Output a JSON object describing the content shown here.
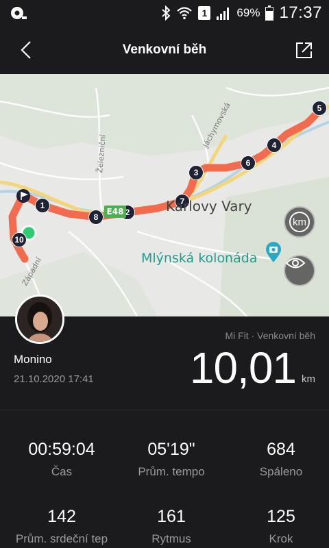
{
  "status_bar": {
    "sim_label": "1",
    "battery": "69%",
    "time": "17:37"
  },
  "header": {
    "title": "Venkovní běh"
  },
  "map": {
    "city_label": "Karlovy Vary",
    "poi_label": "Mlýnská kolonáda",
    "highway_label": "E48",
    "streets": [
      "Železniční",
      "Jáchymovská",
      "Západní"
    ],
    "unit_button": "km",
    "route_color": "#f26b4f",
    "km_markers": [
      "1",
      "2",
      "3",
      "4",
      "5",
      "6",
      "7",
      "8",
      "10"
    ]
  },
  "activity": {
    "source": "Mi Fit · Venkovní běh",
    "user_name": "Monino",
    "date": "21.10.2020 17:41",
    "distance": "10,01",
    "distance_unit": "km"
  },
  "stats": [
    {
      "value": "00:59:04",
      "label": "Čas"
    },
    {
      "value": "05'19\"",
      "label": "Prům. tempo"
    },
    {
      "value": "684",
      "label": "Spáleno"
    },
    {
      "value": "142",
      "label": "Prům. srdeční tep"
    },
    {
      "value": "161",
      "label": "Rytmus"
    },
    {
      "value": "125",
      "label": "Krok"
    }
  ]
}
